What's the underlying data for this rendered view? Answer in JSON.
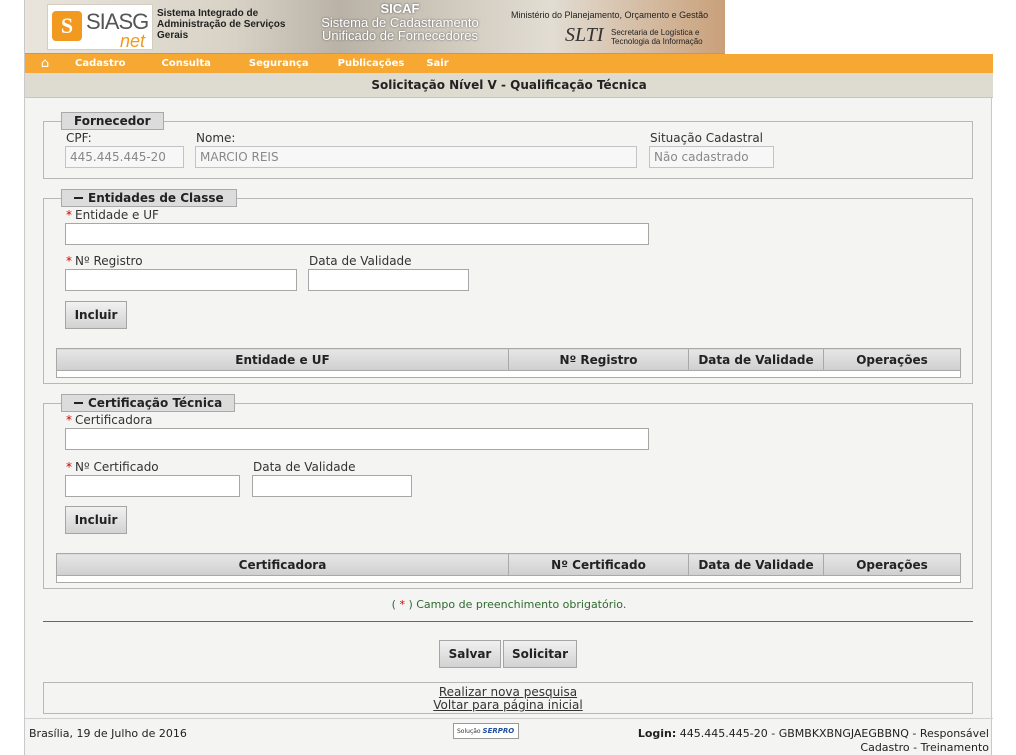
{
  "header": {
    "logo_mark": "S",
    "logo_text": "SIASG",
    "logo_net": "net",
    "system_name": "Sistema Integrado de Administração de Serviços Gerais",
    "sicaf_title": "SICAF",
    "sicaf_subtitle": "Sistema de Cadastramento Unificado de Fornecedores",
    "ministry": "Ministério do Planejamento, Orçamento e Gestão",
    "slti_logo": "SLTI",
    "slti_text": "Secretaria de Logística e Tecnologia da Informação"
  },
  "menu": {
    "home_icon": "home-icon",
    "items": [
      "Cadastro",
      "Consulta",
      "Segurança",
      "Publicações",
      "Sair"
    ]
  },
  "page_title": "Solicitação Nível V - Qualificação Técnica",
  "fornecedor": {
    "legend": "Fornecedor",
    "cpf_label": "CPF:",
    "cpf_value": "445.445.445-20",
    "nome_label": "Nome:",
    "nome_value": "MARCIO REIS",
    "situacao_label": "Situação Cadastral",
    "situacao_value": "Não cadastrado"
  },
  "entidades": {
    "legend": "Entidades de Classe",
    "entidade_label": "Entidade e UF",
    "registro_label": "Nº Registro",
    "validade_label": "Data de Validade",
    "incluir": "Incluir",
    "columns": [
      "Entidade e UF",
      "Nº Registro",
      "Data de Validade",
      "Operações"
    ]
  },
  "certificacao": {
    "legend": "Certificação Técnica",
    "certificadora_label": "Certificadora",
    "certificado_label": "Nº Certificado",
    "validade_label": "Data de Validade",
    "incluir": "Incluir",
    "columns": [
      "Certificadora",
      "Nº Certificado",
      "Data de Validade",
      "Operações"
    ]
  },
  "required_note": {
    "open": "( ",
    "star": "*",
    "close": " ) Campo de preenchimento obrigatório."
  },
  "actions": {
    "salvar": "Salvar",
    "solicitar": "Solicitar"
  },
  "links": {
    "nova_pesquisa": "Realizar nova pesquisa",
    "voltar": "Voltar para página inicial"
  },
  "footer": {
    "date": "Brasília, 19 de Julho de 2016",
    "serpro_prefix": "Solução",
    "serpro": "SERPRO",
    "login_label": "Login:",
    "login_value": "445.445.445-20  - GBMBKXBNGJAEGBBNQ - Responsável",
    "login_line2": "Cadastro - Treinamento"
  }
}
